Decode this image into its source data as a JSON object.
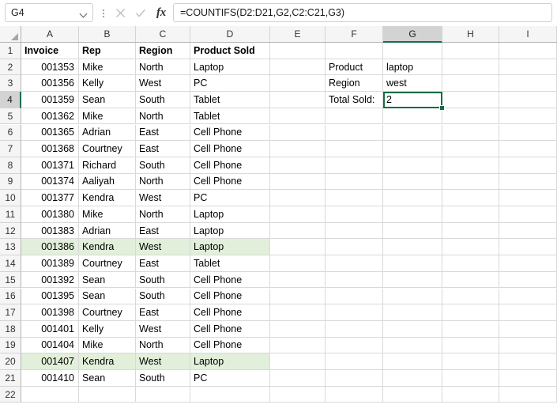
{
  "formula_bar": {
    "name_box_value": "G4",
    "name_box_chevron_icon": "chevron-down-icon",
    "cancel_icon": "x-icon",
    "enter_icon": "check-icon",
    "function_icon": "fx-icon",
    "fx_label": "fx",
    "formula_value": "=COUNTIFS(D2:D21,G2,C2:C21,G3)",
    "formula_placeholder": ""
  },
  "grid": {
    "columns": [
      "A",
      "B",
      "C",
      "D",
      "E",
      "F",
      "G",
      "H",
      "I"
    ],
    "active_column": "G",
    "active_row": 4,
    "rows": [
      1,
      2,
      3,
      4,
      5,
      6,
      7,
      8,
      9,
      10,
      11,
      12,
      13,
      14,
      15,
      16,
      17,
      18,
      19,
      20,
      21,
      22
    ],
    "highlight_color": "#e2efda",
    "selection_color": "#176b42",
    "highlighted_rows": [
      13,
      20
    ]
  },
  "table": {
    "headers": {
      "A": "Invoice",
      "B": "Rep",
      "C": "Region",
      "D": "Product Sold"
    },
    "records": [
      {
        "row": 2,
        "invoice": "001353",
        "rep": "Mike",
        "region": "North",
        "product": "Laptop"
      },
      {
        "row": 3,
        "invoice": "001356",
        "rep": "Kelly",
        "region": "West",
        "product": "PC"
      },
      {
        "row": 4,
        "invoice": "001359",
        "rep": "Sean",
        "region": "South",
        "product": "Tablet"
      },
      {
        "row": 5,
        "invoice": "001362",
        "rep": "Mike",
        "region": "North",
        "product": "Tablet"
      },
      {
        "row": 6,
        "invoice": "001365",
        "rep": "Adrian",
        "region": "East",
        "product": "Cell Phone"
      },
      {
        "row": 7,
        "invoice": "001368",
        "rep": "Courtney",
        "region": "East",
        "product": "Cell Phone"
      },
      {
        "row": 8,
        "invoice": "001371",
        "rep": "Richard",
        "region": "South",
        "product": "Cell Phone"
      },
      {
        "row": 9,
        "invoice": "001374",
        "rep": "Aaliyah",
        "region": "North",
        "product": "Cell Phone"
      },
      {
        "row": 10,
        "invoice": "001377",
        "rep": "Kendra",
        "region": "West",
        "product": "PC"
      },
      {
        "row": 11,
        "invoice": "001380",
        "rep": "Mike",
        "region": "North",
        "product": "Laptop"
      },
      {
        "row": 12,
        "invoice": "001383",
        "rep": "Adrian",
        "region": "East",
        "product": "Laptop"
      },
      {
        "row": 13,
        "invoice": "001386",
        "rep": "Kendra",
        "region": "West",
        "product": "Laptop"
      },
      {
        "row": 14,
        "invoice": "001389",
        "rep": "Courtney",
        "region": "East",
        "product": "Tablet"
      },
      {
        "row": 15,
        "invoice": "001392",
        "rep": "Sean",
        "region": "South",
        "product": "Cell Phone"
      },
      {
        "row": 16,
        "invoice": "001395",
        "rep": "Sean",
        "region": "South",
        "product": "Cell Phone"
      },
      {
        "row": 17,
        "invoice": "001398",
        "rep": "Courtney",
        "region": "East",
        "product": "Cell Phone"
      },
      {
        "row": 18,
        "invoice": "001401",
        "rep": "Kelly",
        "region": "West",
        "product": "Cell Phone"
      },
      {
        "row": 19,
        "invoice": "001404",
        "rep": "Mike",
        "region": "North",
        "product": "Cell Phone"
      },
      {
        "row": 20,
        "invoice": "001407",
        "rep": "Kendra",
        "region": "West",
        "product": "Laptop"
      },
      {
        "row": 21,
        "invoice": "001410",
        "rep": "Sean",
        "region": "South",
        "product": "PC"
      }
    ]
  },
  "criteria_panel": {
    "product_label": "Product",
    "product_value": "laptop",
    "region_label": "Region",
    "region_value": "west",
    "total_label": "Total Sold:",
    "total_value": "2"
  }
}
